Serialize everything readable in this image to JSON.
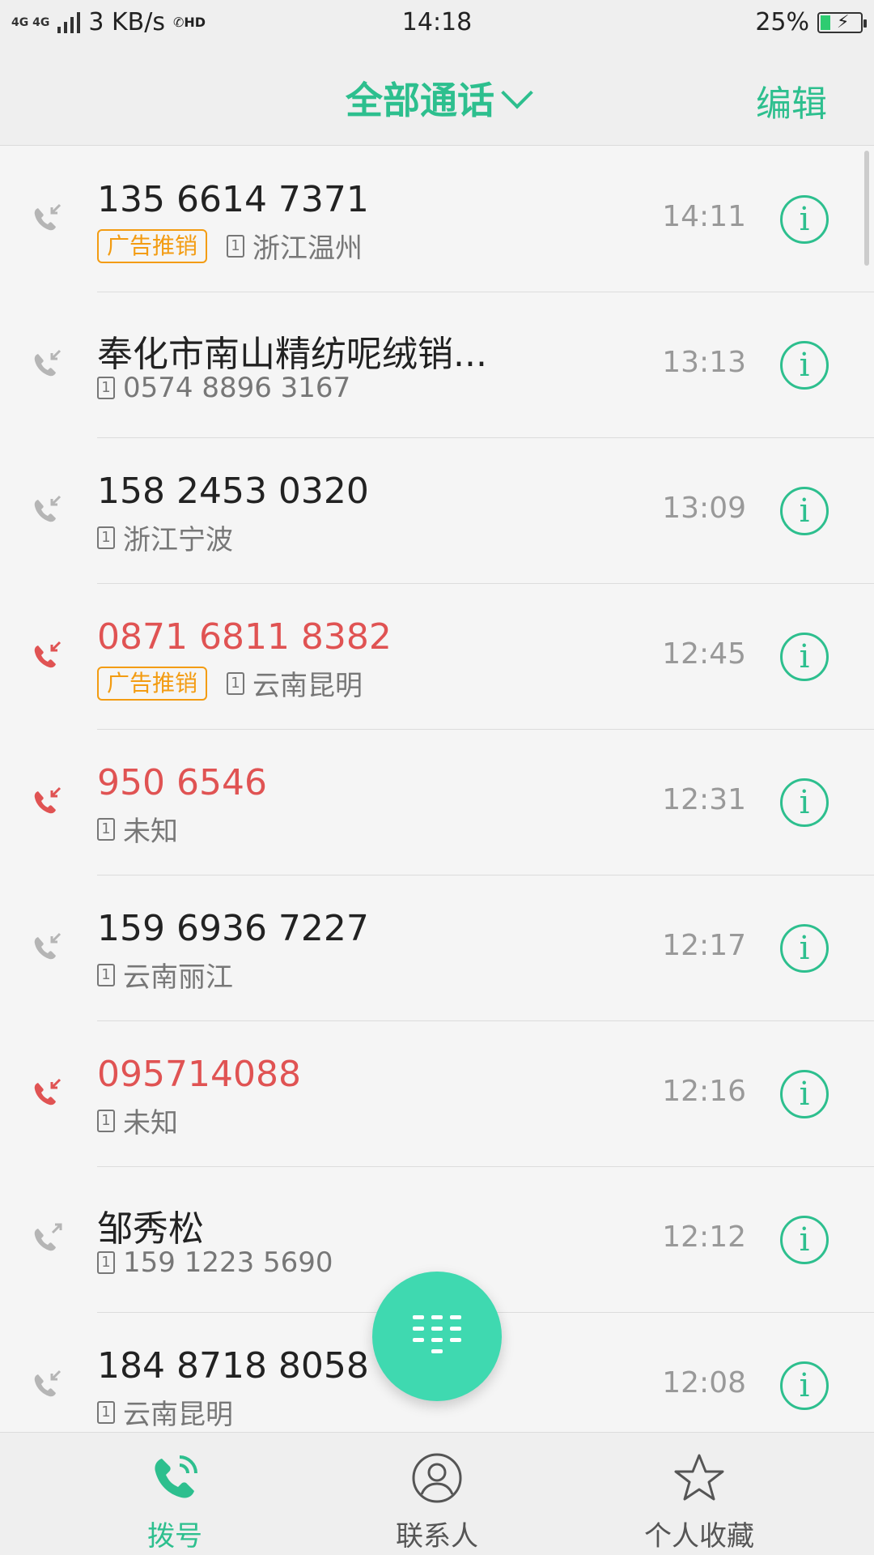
{
  "status_bar": {
    "network": "4G 4G",
    "speed": "3 KB/s",
    "hd": "HD",
    "time": "14:18",
    "battery": "25%",
    "battery_level": 0.25
  },
  "header": {
    "title": "全部通话",
    "edit_label": "编辑"
  },
  "calls": [
    {
      "name": "135 6614 7371",
      "tag": "广告推销",
      "sim": "1",
      "detail": "浙江温州",
      "time": "14:11",
      "type": "incoming"
    },
    {
      "name": "奉化市南山精纺呢绒销...",
      "tag": "",
      "sim": "1",
      "detail": "0574 8896 3167",
      "time": "13:13",
      "type": "incoming"
    },
    {
      "name": "158 2453 0320",
      "tag": "",
      "sim": "1",
      "detail": "浙江宁波",
      "time": "13:09",
      "type": "incoming"
    },
    {
      "name": "0871 6811 8382",
      "tag": "广告推销",
      "sim": "1",
      "detail": "云南昆明",
      "time": "12:45",
      "type": "missed"
    },
    {
      "name": "950 6546",
      "tag": "",
      "sim": "1",
      "detail": "未知",
      "time": "12:31",
      "type": "missed"
    },
    {
      "name": "159 6936 7227",
      "tag": "",
      "sim": "1",
      "detail": "云南丽江",
      "time": "12:17",
      "type": "incoming"
    },
    {
      "name": "095714088",
      "tag": "",
      "sim": "1",
      "detail": "未知",
      "time": "12:16",
      "type": "missed"
    },
    {
      "name": "邹秀松",
      "tag": "",
      "sim": "1",
      "detail": "159 1223 5690",
      "time": "12:12",
      "type": "outgoing"
    },
    {
      "name": "184 8718 8058",
      "tag": "",
      "sim": "1",
      "detail": "云南昆明",
      "time": "12:08",
      "type": "incoming"
    }
  ],
  "info_label": "i",
  "nav": {
    "dial": "拨号",
    "contacts": "联系人",
    "favorites": "个人收藏"
  },
  "colors": {
    "accent": "#2dbf8e",
    "missed": "#e05353",
    "ad_tag": "#f39c12"
  }
}
